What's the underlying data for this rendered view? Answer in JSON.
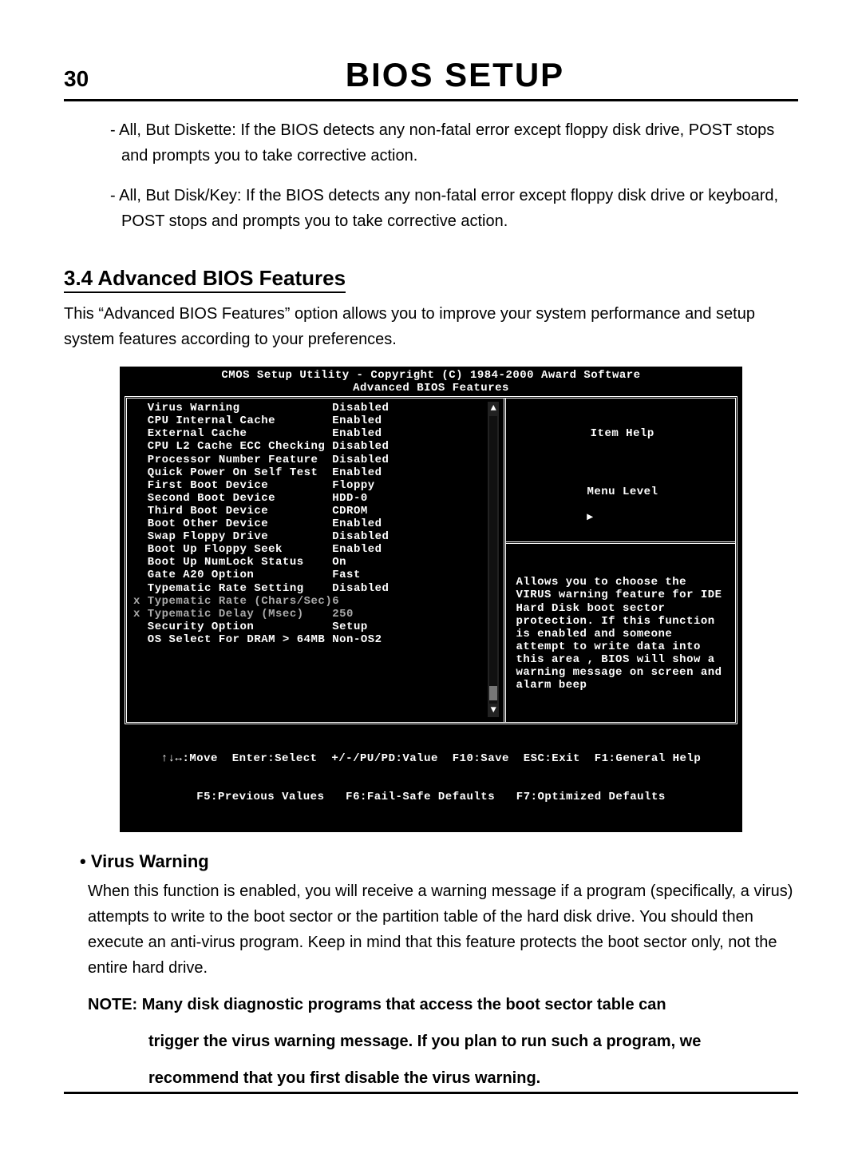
{
  "header": {
    "page_number": "30",
    "title": "BIOS SETUP"
  },
  "intro_bullets": [
    "- All, But Diskette:  If the BIOS detects any non-fatal error except floppy disk drive, POST stops and prompts you to take corrective action.",
    "- All, But Disk/Key:  If the BIOS detects any non-fatal error except floppy disk drive or keyboard, POST stops and prompts you to take corrective action."
  ],
  "section": {
    "number_title": "3.4 Advanced BIOS Features",
    "intro": "This “Advanced BIOS Features” option allows you to improve your system performance and setup system features according to your preferences."
  },
  "bios": {
    "header_line1": "CMOS Setup Utility - Copyright (C) 1984-2000 Award Software",
    "header_line2": "Advanced BIOS Features",
    "settings": [
      {
        "prefix": " ",
        "name": "Virus Warning",
        "value": "Disabled"
      },
      {
        "prefix": " ",
        "name": "CPU Internal Cache",
        "value": "Enabled"
      },
      {
        "prefix": " ",
        "name": "External Cache",
        "value": "Enabled"
      },
      {
        "prefix": " ",
        "name": "CPU L2 Cache ECC Checking",
        "value": "Disabled"
      },
      {
        "prefix": " ",
        "name": "Processor Number Feature",
        "value": "Disabled"
      },
      {
        "prefix": " ",
        "name": "Quick Power On Self Test",
        "value": "Enabled"
      },
      {
        "prefix": " ",
        "name": "First Boot Device",
        "value": "Floppy"
      },
      {
        "prefix": " ",
        "name": "Second Boot Device",
        "value": "HDD-0"
      },
      {
        "prefix": " ",
        "name": "Third Boot Device",
        "value": "CDROM"
      },
      {
        "prefix": " ",
        "name": "Boot Other Device",
        "value": "Enabled"
      },
      {
        "prefix": " ",
        "name": "Swap Floppy Drive",
        "value": "Disabled"
      },
      {
        "prefix": " ",
        "name": "Boot Up Floppy Seek",
        "value": "Enabled"
      },
      {
        "prefix": " ",
        "name": "Boot Up NumLock Status",
        "value": "On"
      },
      {
        "prefix": " ",
        "name": "Gate A20 Option",
        "value": "Fast"
      },
      {
        "prefix": " ",
        "name": "Typematic Rate Setting",
        "value": "Disabled"
      },
      {
        "prefix": "x",
        "name": "Typematic Rate (Chars/Sec)",
        "value": "6",
        "dim": true
      },
      {
        "prefix": "x",
        "name": "Typematic Delay (Msec)",
        "value": "250",
        "dim": true
      },
      {
        "prefix": " ",
        "name": "Security Option",
        "value": "Setup"
      },
      {
        "prefix": " ",
        "name": "OS Select For DRAM > 64MB",
        "value": "Non-OS2"
      }
    ],
    "item_help_label": "Item Help",
    "menu_level_label": "Menu Level",
    "menu_level_arrow": "▸",
    "help_text": "Allows you to choose the VIRUS warning feature for IDE Hard Disk boot sector protection. If this function is enabled and someone attempt to write data into this area ,  BIOS will show a warning message on screen and alarm beep",
    "footer_line1": "↑↓↔:Move  Enter:Select  +/-/PU/PD:Value  F10:Save  ESC:Exit  F1:General Help",
    "footer_line2": "F5:Previous Values   F6:Fail-Safe Defaults   F7:Optimized Defaults",
    "scroll_up": "▲",
    "scroll_down": "▼"
  },
  "virus_warning": {
    "bullet_label": "• Virus Warning",
    "body": "When this  function is enabled, you will receive a warning message if a program (specifically, a virus) attempts to write to the boot sector or the partition table of the hard disk drive.  You should then execute an anti-virus program.  Keep in mind that this feature protects the boot sector only, not the entire hard drive.",
    "note_line1": "NOTE:  Many disk diagnostic programs that access the boot sector table can",
    "note_line2": "trigger the virus warning message.  If you plan to run such a program, we",
    "note_line3": "recommend that you first disable the virus warning."
  }
}
